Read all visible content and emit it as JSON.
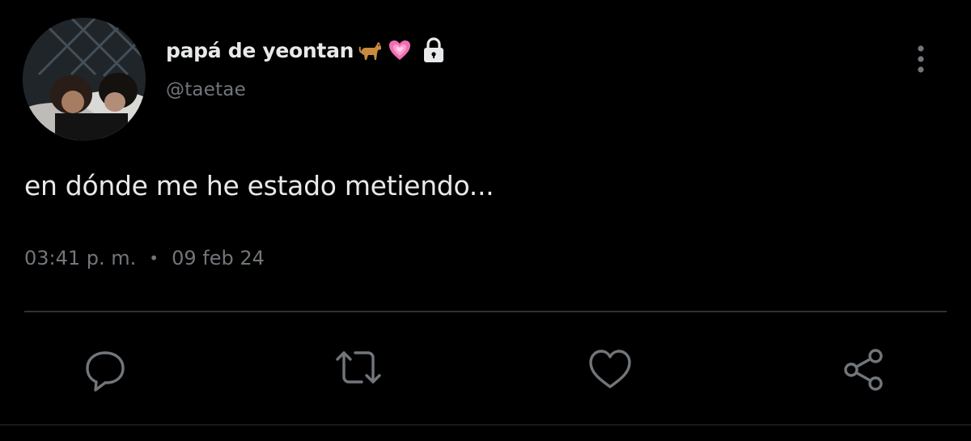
{
  "user": {
    "display_name": "papá de yeontan",
    "name_emojis": [
      "dog-emoji",
      "growing-heart-emoji"
    ],
    "protected_icon": "lock-icon",
    "handle": "@taetae",
    "avatar": "profile-photo"
  },
  "tweet": {
    "text": "en dónde me he estado metiendo...",
    "time": "03:41 p. m.",
    "separator": "•",
    "date": "09 feb 24"
  },
  "actions": {
    "reply_icon": "reply-icon",
    "retweet_icon": "retweet-icon",
    "like_icon": "heart-icon",
    "share_icon": "share-icon",
    "more_icon": "more-vertical-icon"
  },
  "colors": {
    "background": "#000000",
    "primary_text": "#e7e9ea",
    "secondary_text": "#71767b",
    "divider": "#2f3336",
    "heart_emoji": "#f06fb4",
    "dog_emoji": "#c98a3e"
  }
}
